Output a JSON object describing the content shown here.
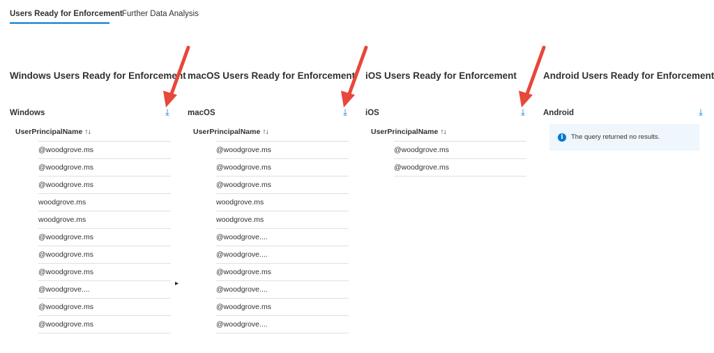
{
  "tabs": [
    {
      "label": "Users Ready for Enforcement",
      "active": true
    },
    {
      "label": "Further Data Analysis",
      "active": false
    }
  ],
  "columns": [
    {
      "title": "Windows Users Ready for Enforcement",
      "subtitle": "Windows",
      "header": "UserPrincipalName",
      "sort_glyph": "↑↓",
      "rows": [
        "@woodgrove.ms",
        "@woodgrove.ms",
        "@woodgrove.ms",
        "woodgrove.ms",
        "woodgrove.ms",
        "@woodgrove.ms",
        "@woodgrove.ms",
        "@woodgrove.ms",
        "@woodgrove....",
        "@woodgrove.ms",
        "@woodgrove.ms"
      ]
    },
    {
      "title": "macOS Users Ready for Enforcement",
      "subtitle": "macOS",
      "header": "UserPrincipalName",
      "sort_glyph": "↑↓",
      "rows": [
        "@woodgrove.ms",
        "@woodgrove.ms",
        "@woodgrove.ms",
        "woodgrove.ms",
        "woodgrove.ms",
        "@woodgrove....",
        "@woodgrove....",
        "@woodgrove.ms",
        "@woodgrove....",
        "@woodgrove.ms",
        "@woodgrove...."
      ]
    },
    {
      "title": "iOS Users Ready for Enforcement",
      "subtitle": "iOS",
      "header": "UserPrincipalName",
      "sort_glyph": "↑↓",
      "rows": [
        "@woodgrove.ms",
        "@woodgrove.ms"
      ]
    },
    {
      "title": "Android Users Ready for Enforcement",
      "subtitle": "Android",
      "info_message": "The query returned no results.",
      "info_icon": "info-icon"
    }
  ],
  "download_icon": {
    "glyph": "⤓",
    "name": "download-icon"
  },
  "colors": {
    "accent": "#0078d4",
    "annotation_arrow": "#e8473b",
    "info_bg": "#eff6fc"
  }
}
